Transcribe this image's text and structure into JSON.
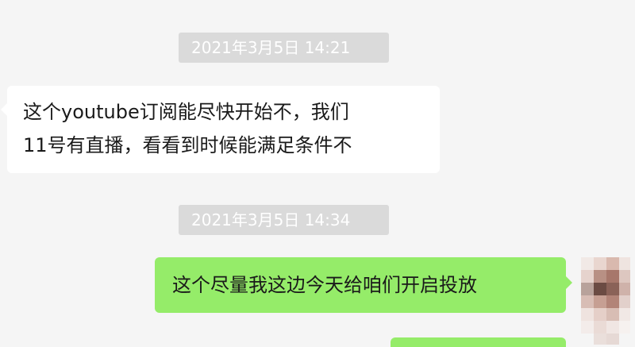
{
  "messages": [
    {
      "type": "timestamp",
      "text": "2021年3月5日 14:21"
    },
    {
      "type": "incoming",
      "lines": [
        "这个youtube订阅能尽快开始不，我们",
        "11号有直播，看看到时候能满足条件不"
      ]
    },
    {
      "type": "timestamp",
      "text": "2021年3月5日 14:34"
    },
    {
      "type": "outgoing",
      "text": "这个尽量我这边今天给咱们开启投放"
    }
  ],
  "colors": {
    "background": "#f5f5f5",
    "incoming_bubble": "#ffffff",
    "outgoing_bubble": "#95ec69",
    "timestamp_bg": "#dadada"
  }
}
